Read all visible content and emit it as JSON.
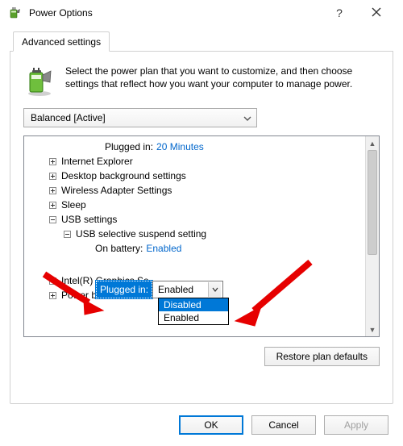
{
  "window": {
    "title": "Power Options"
  },
  "tab": {
    "label": "Advanced settings"
  },
  "intro": {
    "text": "Select the power plan that you want to customize, and then choose settings that reflect how you want your computer to manage power."
  },
  "plan_dropdown": {
    "selected": "Balanced [Active]"
  },
  "tree": {
    "first_row": {
      "label": "Plugged in:",
      "value": "20 Minutes"
    },
    "items": [
      {
        "label": "Internet Explorer",
        "expandable": "plus"
      },
      {
        "label": "Desktop background settings",
        "expandable": "plus"
      },
      {
        "label": "Wireless Adapter Settings",
        "expandable": "plus"
      },
      {
        "label": "Sleep",
        "expandable": "plus"
      },
      {
        "label": "USB settings",
        "expandable": "minus"
      }
    ],
    "usb_child": {
      "label": "USB selective suspend setting",
      "expandable": "minus"
    },
    "usb_battery": {
      "label": "On battery:",
      "value": "Enabled"
    },
    "usb_plugged_label": "Plugged in:",
    "usb_plugged_value": "Enabled",
    "after": [
      {
        "label": "Intel(R) Graphics Se",
        "expandable": "plus"
      },
      {
        "label": "Power buttons and",
        "expandable": "plus"
      }
    ],
    "dropdown_options": [
      "Disabled",
      "Enabled"
    ]
  },
  "restore_button": "Restore plan defaults",
  "buttons": {
    "ok": "OK",
    "cancel": "Cancel",
    "apply": "Apply"
  }
}
